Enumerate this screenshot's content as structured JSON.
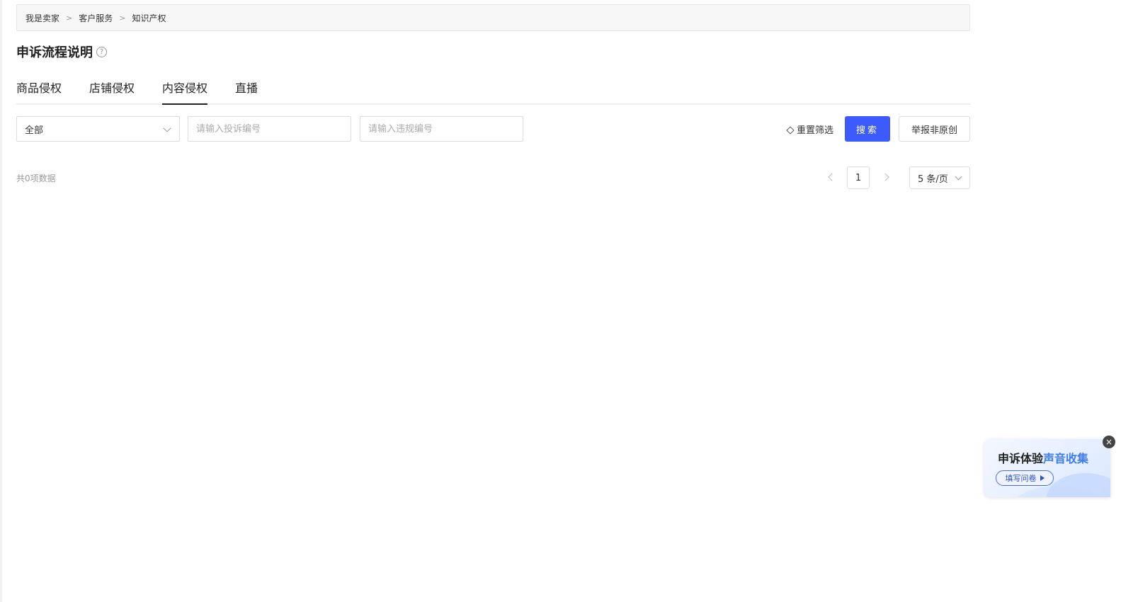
{
  "breadcrumb": {
    "items": [
      "我是卖家",
      "客户服务",
      "知识产权"
    ],
    "separator": ">"
  },
  "header": {
    "title": "申诉流程说明",
    "help_icon_glyph": "?"
  },
  "tabs": [
    {
      "label": "商品侵权",
      "active": false
    },
    {
      "label": "店铺侵权",
      "active": false
    },
    {
      "label": "内容侵权",
      "active": true
    },
    {
      "label": "直播",
      "active": false
    }
  ],
  "filters": {
    "status_select": {
      "selected": "全部"
    },
    "complaint_no": {
      "placeholder": "请输入投诉编号",
      "value": ""
    },
    "violation_no": {
      "placeholder": "请输入违规编号",
      "value": ""
    },
    "reset_label": "重置筛选",
    "search_label": "搜索",
    "report_label": "举报非原创"
  },
  "results": {
    "total_text": "共0项数据"
  },
  "pagination": {
    "current_page": "1",
    "page_size": "5 条/页"
  },
  "survey": {
    "title_prefix": "申诉体验",
    "title_accent": "声音收集",
    "button_label": "填写问卷",
    "close_glyph": "×"
  },
  "colors": {
    "primary": "#3d5afe",
    "survey_accent": "#3d7cf5"
  }
}
